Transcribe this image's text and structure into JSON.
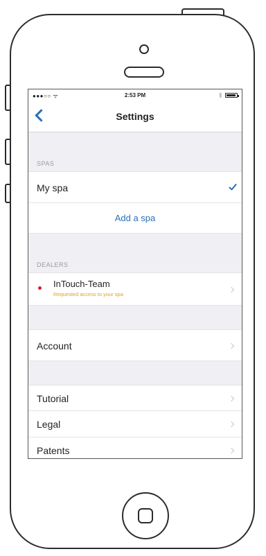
{
  "status_bar": {
    "carrier": "●●●○○ ᯤ",
    "time": "2:53 PM"
  },
  "nav": {
    "title": "Settings"
  },
  "spas": {
    "header": "SPAS",
    "items": [
      {
        "label": "My spa",
        "selected": true
      }
    ],
    "add_label": "Add a spa"
  },
  "dealers": {
    "header": "DEALERS",
    "items": [
      {
        "name": "InTouch-Team",
        "status": "Requested access to your spa"
      }
    ]
  },
  "menu": {
    "account": "Account",
    "tutorial": "Tutorial",
    "legal": "Legal",
    "patents": "Patents"
  },
  "colors": {
    "accent": "#2a6fb5",
    "warning": "#e0a020",
    "dot": "#d2232a",
    "group_bg": "#efeff4"
  }
}
